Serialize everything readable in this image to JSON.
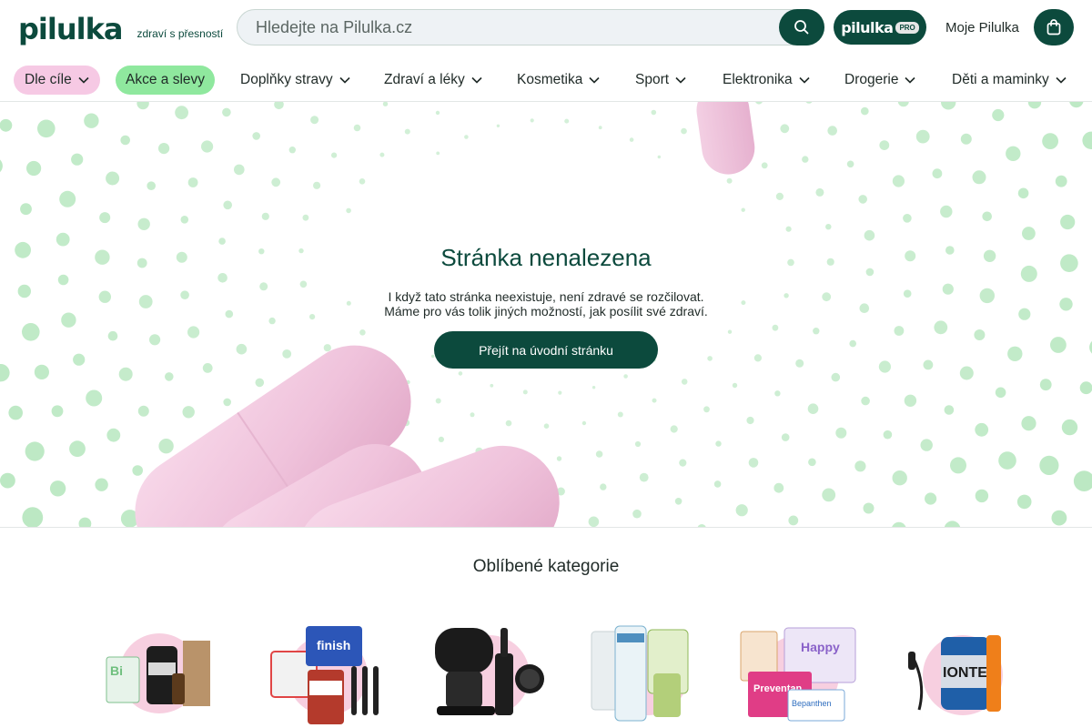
{
  "header": {
    "logo_text": "pilulka",
    "tagline": "zdraví s přesností",
    "search_placeholder": "Hledejte na Pilulka.cz",
    "pro_label": "pilulka",
    "pro_badge": "PRO",
    "account_label": "Moje Pilulka"
  },
  "nav": {
    "items": [
      {
        "label": "Dle cíle"
      },
      {
        "label": "Akce a slevy"
      },
      {
        "label": "Doplňky stravy"
      },
      {
        "label": "Zdraví a léky"
      },
      {
        "label": "Kosmetika"
      },
      {
        "label": "Sport"
      },
      {
        "label": "Elektronika"
      },
      {
        "label": "Drogerie"
      },
      {
        "label": "Děti a maminky"
      }
    ]
  },
  "hero": {
    "title": "Stránka nenalezena",
    "text_line1": "I když tato stránka neexistuje, není zdravé se rozčilovat.",
    "text_line2": "Máme pro vás tolik jiných možností, jak posílit své zdraví.",
    "button_label": "Přejít na úvodní stránku"
  },
  "categories": {
    "title": "Oblíbené kategorie"
  },
  "colors": {
    "brand": "#0c4a3d",
    "pink_pill": "#f6c9e4",
    "green_pill": "#8fe89e",
    "dots": "#b5e6bd",
    "capsule": "#f0c4dc"
  }
}
